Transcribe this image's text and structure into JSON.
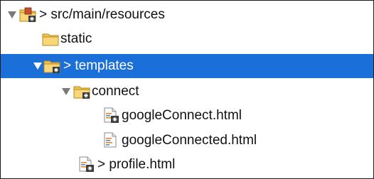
{
  "tree": {
    "items": [
      {
        "label": "> src/main/resources",
        "icon": "package-folder-icon",
        "expanded": true,
        "selected": false
      },
      {
        "label": "static",
        "icon": "folder-icon",
        "expanded": false,
        "selected": false
      },
      {
        "label": "> templates",
        "icon": "package-folder-icon",
        "expanded": true,
        "selected": true
      },
      {
        "label": "connect",
        "icon": "package-folder-icon",
        "expanded": true,
        "selected": false
      },
      {
        "label": "googleConnect.html",
        "icon": "html-file-versioned-icon",
        "selected": false
      },
      {
        "label": "googleConnected.html",
        "icon": "html-file-icon",
        "selected": false
      },
      {
        "label": "> profile.html",
        "icon": "html-file-versioned-icon",
        "selected": false
      }
    ]
  },
  "colors": {
    "selection": "#1a6fd8",
    "folder": "#f0c24e",
    "border": "#1a1a1a"
  }
}
